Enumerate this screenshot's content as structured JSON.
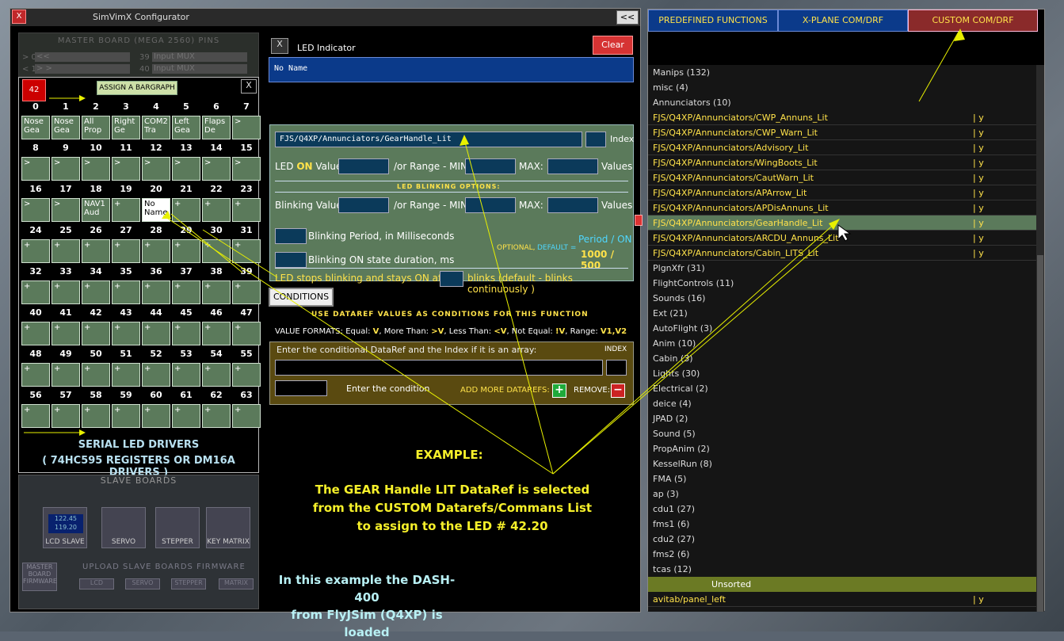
{
  "window": {
    "title": "SimVimX Configurator",
    "close_label": "X",
    "collapse_label": "<<"
  },
  "master": {
    "title": "MASTER BOARD (MEGA 2560) PINS",
    "r0_pin": "> 0",
    "r0_val": "<<",
    "r0_pin2": "39",
    "r0_val2": "Input MUX",
    "r1_pin": "< 1",
    "r1_val": "> >",
    "r1_pin2": "40",
    "r1_val2": "Input MUX"
  },
  "grid": {
    "badge": "42",
    "bargraph_label": "ASSIGN A BARGRAPH",
    "close_label": "X",
    "rows": [
      {
        "nums": [
          "0",
          "1",
          "2",
          "3",
          "4",
          "5",
          "6",
          "7"
        ],
        "cells": [
          "Nose Gea",
          "Nose Gea",
          "All Prop",
          "Right Ge",
          "COM2 Tra",
          "Left Gea",
          "Flaps De",
          ">"
        ]
      },
      {
        "nums": [
          "8",
          "9",
          "10",
          "11",
          "12",
          "13",
          "14",
          "15"
        ],
        "cells": [
          ">",
          ">",
          ">",
          ">",
          ">",
          ">",
          ">",
          ">"
        ]
      },
      {
        "nums": [
          "16",
          "17",
          "18",
          "19",
          "20",
          "21",
          "22",
          "23"
        ],
        "cells": [
          ">",
          ">",
          "NAV1 Aud",
          "+",
          "No Name",
          "+",
          "+",
          "+"
        ]
      },
      {
        "nums": [
          "24",
          "25",
          "26",
          "27",
          "28",
          "29",
          "30",
          "31"
        ],
        "cells": [
          "+",
          "+",
          "+",
          "+",
          "+",
          "+",
          "+",
          "+"
        ]
      },
      {
        "nums": [
          "32",
          "33",
          "34",
          "35",
          "36",
          "37",
          "38",
          "39"
        ],
        "cells": [
          "+",
          "+",
          "+",
          "+",
          "+",
          "+",
          "+",
          "+"
        ]
      },
      {
        "nums": [
          "40",
          "41",
          "42",
          "43",
          "44",
          "45",
          "46",
          "47"
        ],
        "cells": [
          "+",
          "+",
          "+",
          "+",
          "+",
          "+",
          "+",
          "+"
        ]
      },
      {
        "nums": [
          "48",
          "49",
          "50",
          "51",
          "52",
          "53",
          "54",
          "55"
        ],
        "cells": [
          "+",
          "+",
          "+",
          "+",
          "+",
          "+",
          "+",
          "+"
        ]
      },
      {
        "nums": [
          "56",
          "57",
          "58",
          "59",
          "60",
          "61",
          "62",
          "63"
        ],
        "cells": [
          "+",
          "+",
          "+",
          "+",
          "+",
          "+",
          "+",
          "+"
        ]
      }
    ],
    "serial_line1": "SERIAL   LED   DRIVERS",
    "serial_line2": "( 74HC595 REGISTERS  OR  DM16A DRIVERS )"
  },
  "slave": {
    "title": "SLAVE  BOARDS",
    "boards": [
      "LCD SLAVE",
      "SERVO",
      "STEPPER",
      "KEY MATRIX"
    ],
    "lcd_line1": "122.45",
    "lcd_line2": "119.20",
    "upload_label": "UPLOAD  SLAVE  BOARDS  FIRMWARE",
    "master_fw": "MASTER BOARD FIRMWARE",
    "upload_btns": [
      "LCD",
      "SERVO",
      "STEPPER",
      "MATRIX"
    ]
  },
  "led": {
    "close_label": "X",
    "title": "LED Indicator",
    "clear_label": "Clear",
    "name": "No Name",
    "dataref": "FJS/Q4XP/Annunciators/GearHandle_Lit",
    "index_label": "Index",
    "on_label_a": "LED ",
    "on_label_b": "ON",
    "on_label_c": " Value:",
    "range_label": "/or Range - MIN:",
    "max_label": "MAX:",
    "values_label": "Values",
    "blink_options": "LED  BLINKING  OPTIONS:",
    "blink_value_label": "Blinking Value:",
    "blink_period_label": "Blinking  Period, in Milliseconds",
    "blink_on_label": "Blinking  ON state duration, ms",
    "optional_label": "OPTIONAL, ",
    "default_label": "DEFAULT =",
    "period_on_label": "Period / ON",
    "period_on_values": "1000 / 500",
    "stops_label": "LED stops blinking and stays ON after",
    "blinks_label": "blinks  (default - blinks continuously )"
  },
  "conditions": {
    "button_label": "CONDITIONS",
    "use_label": "USE  DATAREF  VALUES  AS  CONDITIONS FOR THIS FUNCTION",
    "formats_a": "VALUE FORMATS:  Equal: ",
    "formats_v": "V",
    "formats_b": ",  More Than: ",
    "formats_gt": ">V",
    "formats_c": ",  Less Than: ",
    "formats_lt": "<V",
    "formats_d": ",  Not Equal: ",
    "formats_ne": "!V",
    "formats_e": ",  Range: ",
    "formats_rng": "V1,V2",
    "enter_label": "Enter the conditional DataRef and the Index if it is an array:",
    "index_label": "INDEX",
    "enter_condition": "Enter the condition",
    "add_more": "ADD MORE DATAREFS:",
    "remove": "REMOVE:"
  },
  "example": {
    "title": "EXAMPLE:",
    "line1": "The GEAR Handle LIT DataRef is selected",
    "line2": "from the  CUSTOM Datarefs/Commans List",
    "line3": "to assign  to  the LED # 42.20",
    "dash1": "In this example the DASH-400",
    "dash2": "from FlyJSim (Q4XP) is loaded"
  },
  "right": {
    "tabs": [
      "PREDEFINED FUNCTIONS",
      "X-PLANE COM/DRF",
      "CUSTOM COM/DRF"
    ],
    "active_tab": 2,
    "items": [
      {
        "t": "Manips (132)",
        "type": "group"
      },
      {
        "t": "misc (4)",
        "type": "group"
      },
      {
        "t": "Annunciators (10)",
        "type": "group"
      },
      {
        "t": "FJS/Q4XP/Annunciators/CWP_Annuns_Lit",
        "flag": "| y",
        "type": "dr"
      },
      {
        "t": "FJS/Q4XP/Annunciators/CWP_Warn_Lit",
        "flag": "| y",
        "type": "dr"
      },
      {
        "t": "FJS/Q4XP/Annunciators/Advisory_Lit",
        "flag": "| y",
        "type": "dr"
      },
      {
        "t": "FJS/Q4XP/Annunciators/WingBoots_Lit",
        "flag": "| y",
        "type": "dr"
      },
      {
        "t": "FJS/Q4XP/Annunciators/CautWarn_Lit",
        "flag": "| y",
        "type": "dr"
      },
      {
        "t": "FJS/Q4XP/Annunciators/APArrow_Lit",
        "flag": "| y",
        "type": "dr"
      },
      {
        "t": "FJS/Q4XP/Annunciators/APDisAnnuns_Lit",
        "flag": "| y",
        "type": "dr"
      },
      {
        "t": "FJS/Q4XP/Annunciators/GearHandle_Lit",
        "flag": "| y",
        "type": "dr",
        "hl": true
      },
      {
        "t": "FJS/Q4XP/Annunciators/ARCDU_Annuns_Lit",
        "flag": "| y",
        "type": "dr"
      },
      {
        "t": "FJS/Q4XP/Annunciators/Cabin_LITS_Lit",
        "flag": "| y",
        "type": "dr"
      },
      {
        "t": "PlgnXfr (31)",
        "type": "group"
      },
      {
        "t": "FlightControls (11)",
        "type": "group"
      },
      {
        "t": "Sounds (16)",
        "type": "group"
      },
      {
        "t": "Ext (21)",
        "type": "group"
      },
      {
        "t": "AutoFlight (3)",
        "type": "group"
      },
      {
        "t": "Anim (10)",
        "type": "group"
      },
      {
        "t": "Cabin (3)",
        "type": "group"
      },
      {
        "t": "Lights (30)",
        "type": "group"
      },
      {
        "t": "Electrical (2)",
        "type": "group"
      },
      {
        "t": "deice (4)",
        "type": "group"
      },
      {
        "t": "JPAD (2)",
        "type": "group"
      },
      {
        "t": "Sound (5)",
        "type": "group"
      },
      {
        "t": "PropAnim (2)",
        "type": "group"
      },
      {
        "t": "KesselRun (8)",
        "type": "group"
      },
      {
        "t": "FMA (5)",
        "type": "group"
      },
      {
        "t": "ap (3)",
        "type": "group"
      },
      {
        "t": "cdu1 (27)",
        "type": "group"
      },
      {
        "t": "fms1 (6)",
        "type": "group"
      },
      {
        "t": "cdu2 (27)",
        "type": "group"
      },
      {
        "t": "fms2 (6)",
        "type": "group"
      },
      {
        "t": "tcas (12)",
        "type": "group"
      },
      {
        "t": "Unsorted",
        "type": "unsorted"
      },
      {
        "t": "avitab/panel_left",
        "flag": "| y",
        "type": "dr"
      }
    ]
  }
}
